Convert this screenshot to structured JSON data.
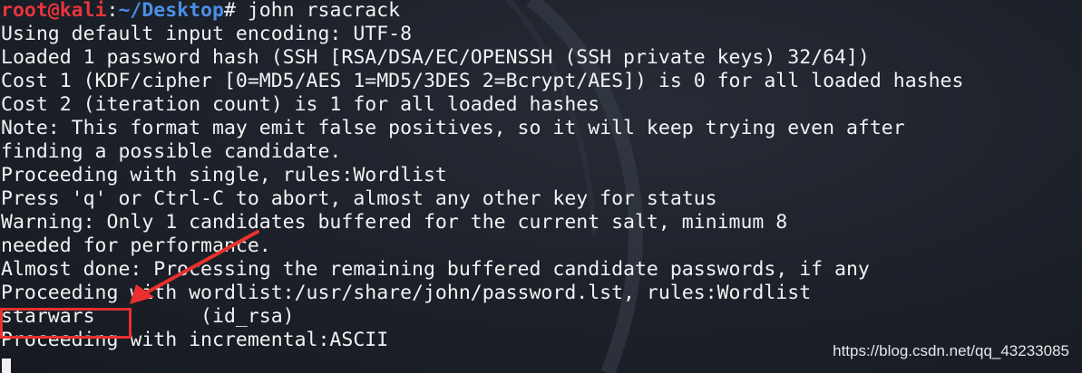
{
  "terminal": {
    "prompt": {
      "user_host": "root@kali",
      "separator": ":",
      "path": "~/Desktop",
      "symbol": "#",
      "command": " john rsacrack"
    },
    "output_lines": [
      "Using default input encoding: UTF-8",
      "Loaded 1 password hash (SSH [RSA/DSA/EC/OPENSSH (SSH private keys) 32/64])",
      "Cost 1 (KDF/cipher [0=MD5/AES 1=MD5/3DES 2=Bcrypt/AES]) is 0 for all loaded hashes",
      "Cost 2 (iteration count) is 1 for all loaded hashes",
      "Note: This format may emit false positives, so it will keep trying even after",
      "finding a possible candidate.",
      "Proceeding with single, rules:Wordlist",
      "Press 'q' or Ctrl-C to abort, almost any other key for status",
      "Warning: Only 1 candidates buffered for the current salt, minimum 8",
      "needed for performance.",
      "Almost done: Processing the remaining buffered candidate passwords, if any",
      "Proceeding with wordlist:/usr/share/john/password.lst, rules:Wordlist",
      "starwars         (id_rsa)",
      "Proceeding with incremental:ASCII"
    ],
    "colors": {
      "background": "#1c2029",
      "text": "#f2f2f2",
      "prompt_user": "#e5353d",
      "prompt_path": "#4a8fe7",
      "annotation": "#e8312f"
    }
  },
  "annotation": {
    "highlighted_text": "starwars",
    "arrow_icon": "arrow-icon"
  },
  "watermark": "https://blog.csdn.net/qq_43233085"
}
